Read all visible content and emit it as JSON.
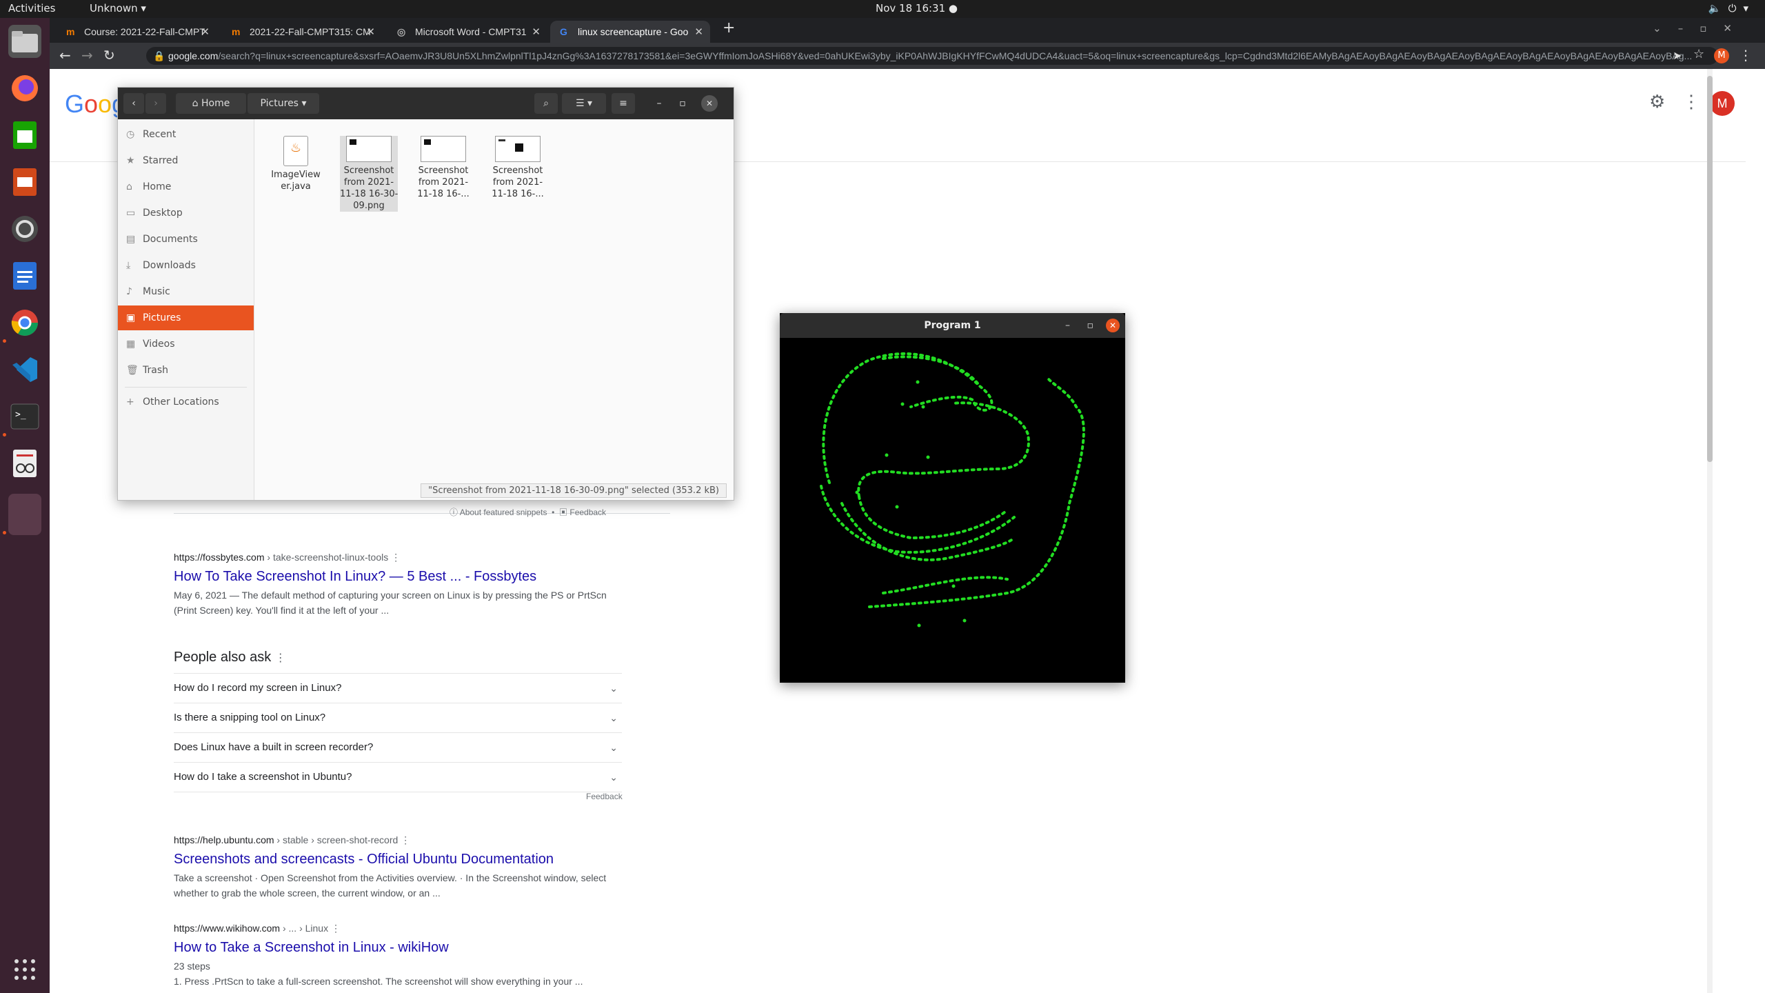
{
  "topbar": {
    "activities": "Activities",
    "app": "Unknown ▾",
    "clock": "Nov 18  16:31",
    "indicator": "●"
  },
  "browser": {
    "tabs": [
      {
        "label": "Course: 2021-22-Fall-CMPT",
        "icon": "moodle-icon"
      },
      {
        "label": "2021-22-Fall-CMPT315: CM",
        "icon": "moodle-icon"
      },
      {
        "label": "Microsoft Word - CMPT31",
        "icon": "globe-icon"
      },
      {
        "label": "linux screencapture - Goo",
        "icon": "google-icon"
      }
    ],
    "url_domain": "google.com",
    "url_rest": "/search?q=linux+screencapture&sxsrf=AOaemvJR3U8Un5XLhmZwlpnlTl1pJ4znGg%3A1637278173581&ei=3eGWYffmIomJoASHi68Y&ved=0ahUKEwi3yby_iKP0AhWJBIgKHYfFCwMQ4dUDCA4&uact=5&oq=linux+screencapture&gs_lcp=Cgdnd3Mtd2l6EAMyBAgAEAoyBAgAEAoyBAgAEAoyBAgAEAoyBAgAEAoyBAgAEAoyBAgAEAoyBAg..."
  },
  "google": {
    "logo": "Google",
    "avatar": "M",
    "featured_meta": {
      "about": "About featured snippets",
      "feedback": "Feedback"
    },
    "results": [
      {
        "cite": "https://fossbytes.com",
        "cite_path": " › take-screenshot-linux-tools",
        "title": "How To Take Screenshot In Linux? — 5 Best ... - Fossbytes",
        "snippet": "May 6, 2021 — The default method of capturing your screen on Linux is by pressing the PS or PrtScn (Print Screen) key. You'll find it at the left of your ..."
      },
      {
        "cite": "https://help.ubuntu.com",
        "cite_path": " › stable › screen-shot-record",
        "title": "Screenshots and screencasts - Official Ubuntu Documentation",
        "snippet": "Take a screenshot · Open Screenshot from the Activities overview. · In the Screenshot window, select whether to grab the whole screen, the current window, or an ..."
      },
      {
        "cite": "https://www.wikihow.com",
        "cite_path": " › ... › Linux",
        "title": "How to Take a Screenshot in Linux - wikiHow",
        "snippet": "23 steps",
        "snippet2": "1.  Press .PrtScn to take a full-screen screenshot. The screenshot will show everything in your ..."
      }
    ],
    "paa": {
      "title": "People also ask",
      "questions": [
        "How do I record my screen in Linux?",
        "Is there a snipping tool on Linux?",
        "Does Linux have a built in screen recorder?",
        "How do I take a screenshot in Ubuntu?"
      ],
      "feedback": "Feedback"
    }
  },
  "files": {
    "path": [
      "Home",
      "Pictures"
    ],
    "sidebar": [
      {
        "label": "Recent",
        "icon": "clock-icon"
      },
      {
        "label": "Starred",
        "icon": "star-icon"
      },
      {
        "label": "Home",
        "icon": "home-icon"
      },
      {
        "label": "Desktop",
        "icon": "desktop-icon"
      },
      {
        "label": "Documents",
        "icon": "document-icon"
      },
      {
        "label": "Downloads",
        "icon": "download-icon"
      },
      {
        "label": "Music",
        "icon": "music-icon"
      },
      {
        "label": "Pictures",
        "icon": "picture-icon"
      },
      {
        "label": "Videos",
        "icon": "video-icon"
      },
      {
        "label": "Trash",
        "icon": "trash-icon"
      },
      {
        "label": "Other Locations",
        "icon": "plus-icon"
      }
    ],
    "items": [
      {
        "name": "ImageView\ner.java",
        "type": "java"
      },
      {
        "name": "Screenshot\nfrom 2021-\n11-18 16-30-\n09.png",
        "type": "png",
        "selected": true
      },
      {
        "name": "Screenshot\nfrom 2021-\n11-18 16-...",
        "type": "png"
      },
      {
        "name": "Screenshot\nfrom 2021-\n11-18 16-...",
        "type": "png"
      }
    ],
    "status": "\"Screenshot from 2021-11-18 16-30-09.png\" selected  (353.2 kB)"
  },
  "program": {
    "title": "Program 1",
    "stroke_color": "#22dd22"
  },
  "colors": {
    "accent": "#e95420",
    "link": "#1a0dab"
  }
}
